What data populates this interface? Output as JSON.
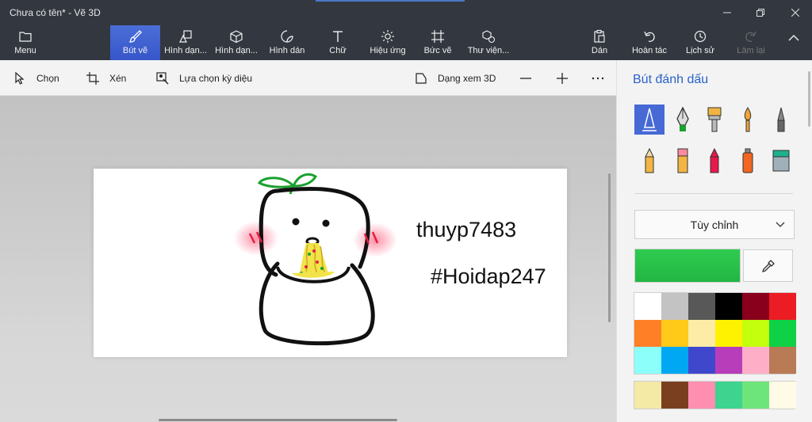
{
  "window": {
    "title": "Chưa có tên* - Vẽ 3D",
    "controls": [
      "minimize",
      "restore",
      "close"
    ]
  },
  "ribbon": {
    "menu": "Menu",
    "tools": [
      {
        "id": "brushes",
        "label": "Bút vẽ",
        "icon": "brush-icon",
        "active": true
      },
      {
        "id": "shapes2d",
        "label": "Hình dạn...",
        "icon": "2d-shapes-icon"
      },
      {
        "id": "shapes3d",
        "label": "Hình dạn...",
        "icon": "3d-shapes-icon"
      },
      {
        "id": "stickers",
        "label": "Hình dán",
        "icon": "sticker-icon"
      },
      {
        "id": "text",
        "label": "Chữ",
        "icon": "text-icon"
      },
      {
        "id": "effects",
        "label": "Hiệu ứng",
        "icon": "effects-icon"
      },
      {
        "id": "canvas",
        "label": "Bức vẽ",
        "icon": "canvas-icon"
      },
      {
        "id": "library",
        "label": "Thư viện...",
        "icon": "3d-library-icon"
      }
    ],
    "actions": [
      {
        "id": "paste",
        "label": "Dán",
        "icon": "paste-icon"
      },
      {
        "id": "undo",
        "label": "Hoàn tác",
        "icon": "undo-icon"
      },
      {
        "id": "history",
        "label": "Lịch sử",
        "icon": "history-icon"
      },
      {
        "id": "redo",
        "label": "Làm lại",
        "icon": "redo-icon",
        "disabled": true
      }
    ]
  },
  "toolbar": {
    "select": "Chọn",
    "crop": "Xén",
    "magic_select": "Lựa chọn kỳ diệu",
    "view_3d": "Dạng xem 3D"
  },
  "canvas": {
    "texts": [
      "thuyp7483",
      "#Hoidap247"
    ]
  },
  "panel": {
    "title": "Bút đánh dấu",
    "brushes": [
      {
        "name": "marker",
        "selected": true
      },
      {
        "name": "calligraphy-pen"
      },
      {
        "name": "oil-brush"
      },
      {
        "name": "watercolor"
      },
      {
        "name": "pixel-pen"
      },
      {
        "name": "pencil"
      },
      {
        "name": "eraser"
      },
      {
        "name": "crayon"
      },
      {
        "name": "spray-can"
      },
      {
        "name": "fill"
      }
    ],
    "texture_dropdown": "Tùy chỉnh",
    "current_color": "#22b643",
    "palette": [
      "#ffffff",
      "#c3c3c3",
      "#585858",
      "#000000",
      "#88001b",
      "#ec1c24",
      "#ff7f27",
      "#ffca18",
      "#fdeca6",
      "#fff200",
      "#c4ff0e",
      "#0ed145",
      "#8cfffb",
      "#00a8f3",
      "#3f48cc",
      "#b83dba",
      "#ffaec8",
      "#b97a56"
    ],
    "palette_custom": [
      "#f5e9a6",
      "#7a3f1f",
      "#ff8fb0",
      "#3ed38f",
      "#6ee57a",
      "#fffbe6"
    ]
  }
}
